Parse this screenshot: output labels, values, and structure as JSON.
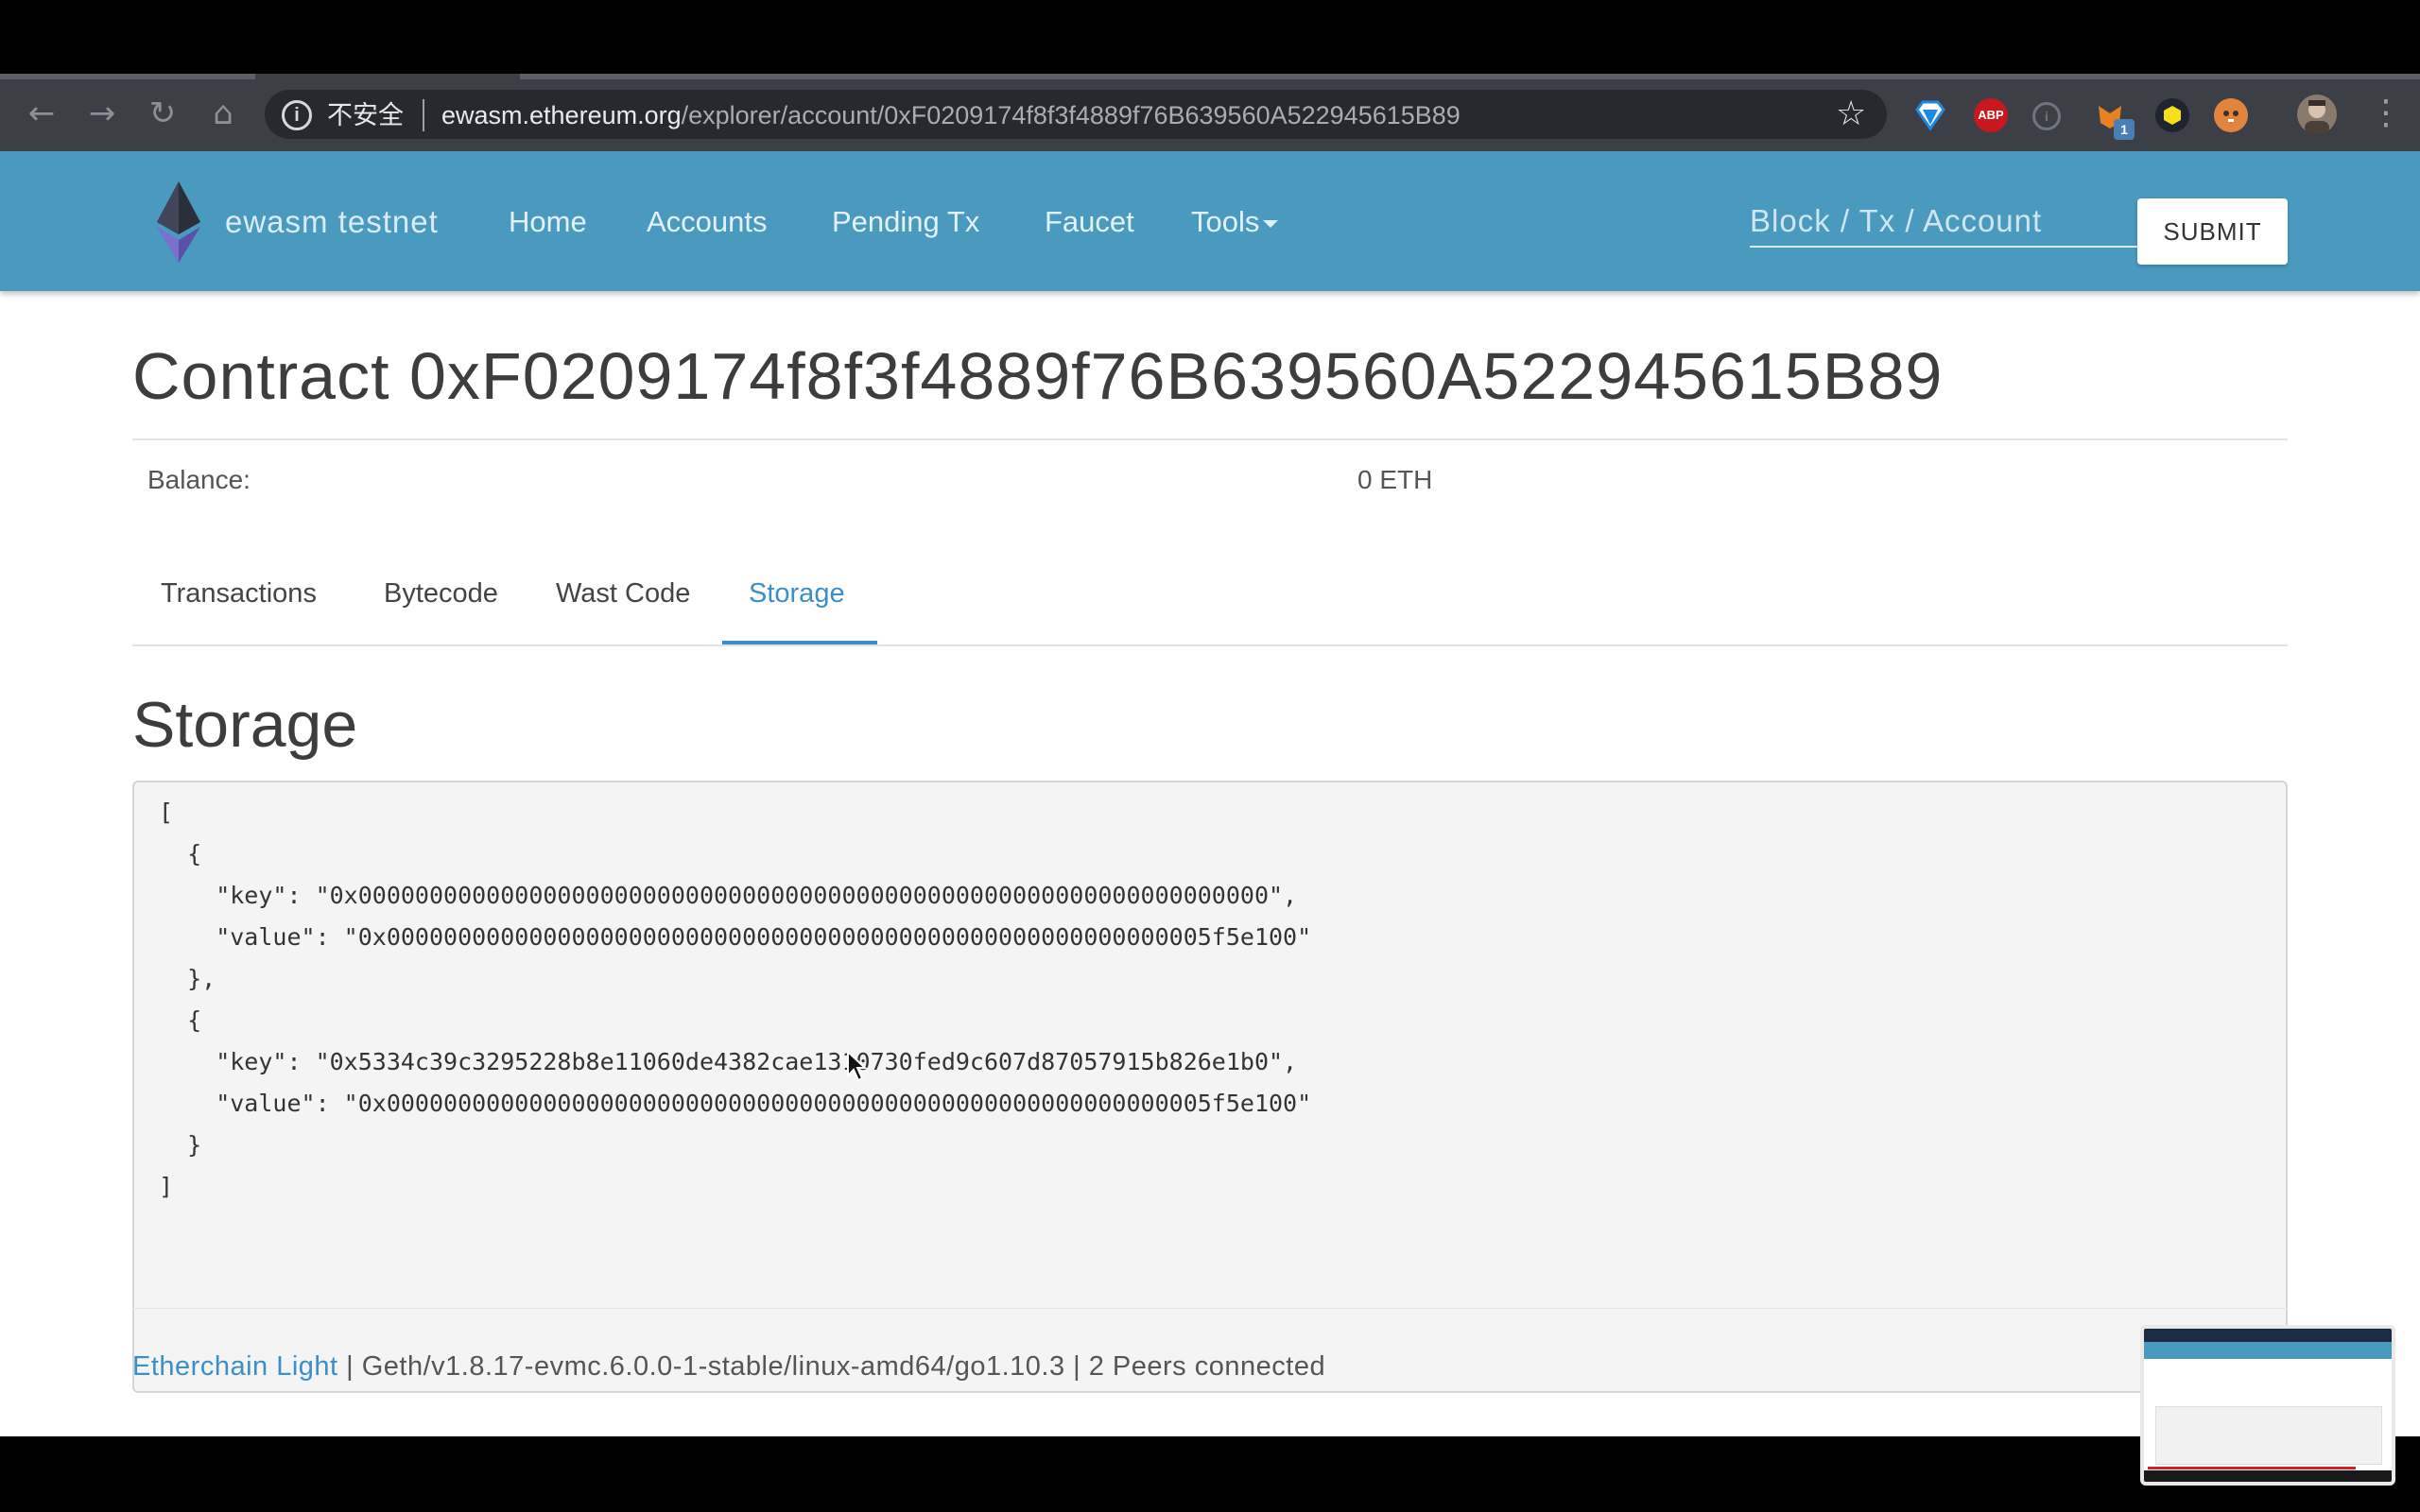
{
  "browser": {
    "security_label": "不安全",
    "url_host": "ewasm.ethereum.org",
    "url_path": "/explorer/account/0xF0209174f8f3f4889f76B639560A522945615B89",
    "extensions": [
      "bitwarden-icon",
      "adblock-plus-icon",
      "info-extension-icon",
      "metamask-icon",
      "hex-extension-icon",
      "brave-tiger-icon"
    ],
    "abp_label": "ABP",
    "metamask_badge": "1"
  },
  "navbar": {
    "brand": "ewasm testnet",
    "items": [
      "Home",
      "Accounts",
      "Pending Tx",
      "Faucet",
      "Tools"
    ],
    "search_placeholder": "Block / Tx / Account",
    "submit_label": "SUBMIT"
  },
  "page": {
    "title": "Contract 0xF0209174f8f3f4889f76B639560A522945615B89",
    "balance_label": "Balance:",
    "balance_value": "0 ETH",
    "tabs": [
      "Transactions",
      "Bytecode",
      "Wast Code",
      "Storage"
    ],
    "active_tab": "Storage",
    "section_title": "Storage",
    "storage_json": "[\n  {\n    \"key\": \"0x0000000000000000000000000000000000000000000000000000000000000000\",\n    \"value\": \"0x0000000000000000000000000000000000000000000000000000000005f5e100\"\n  },\n  {\n    \"key\": \"0x5334c39c3295228b8e11060de4382cae1310730fed9c607d87057915b826e1b0\",\n    \"value\": \"0x0000000000000000000000000000000000000000000000000000000005f5e100\"\n  }\n]"
  },
  "footer": {
    "link": "Etherchain Light",
    "text": " | Geth/v1.8.17-evmc.6.0.0-1-stable/linux-amd64/go1.10.3 | 2 Peers connected"
  },
  "colors": {
    "navbar": "#4a9abf",
    "accent": "#3a8fc9"
  }
}
